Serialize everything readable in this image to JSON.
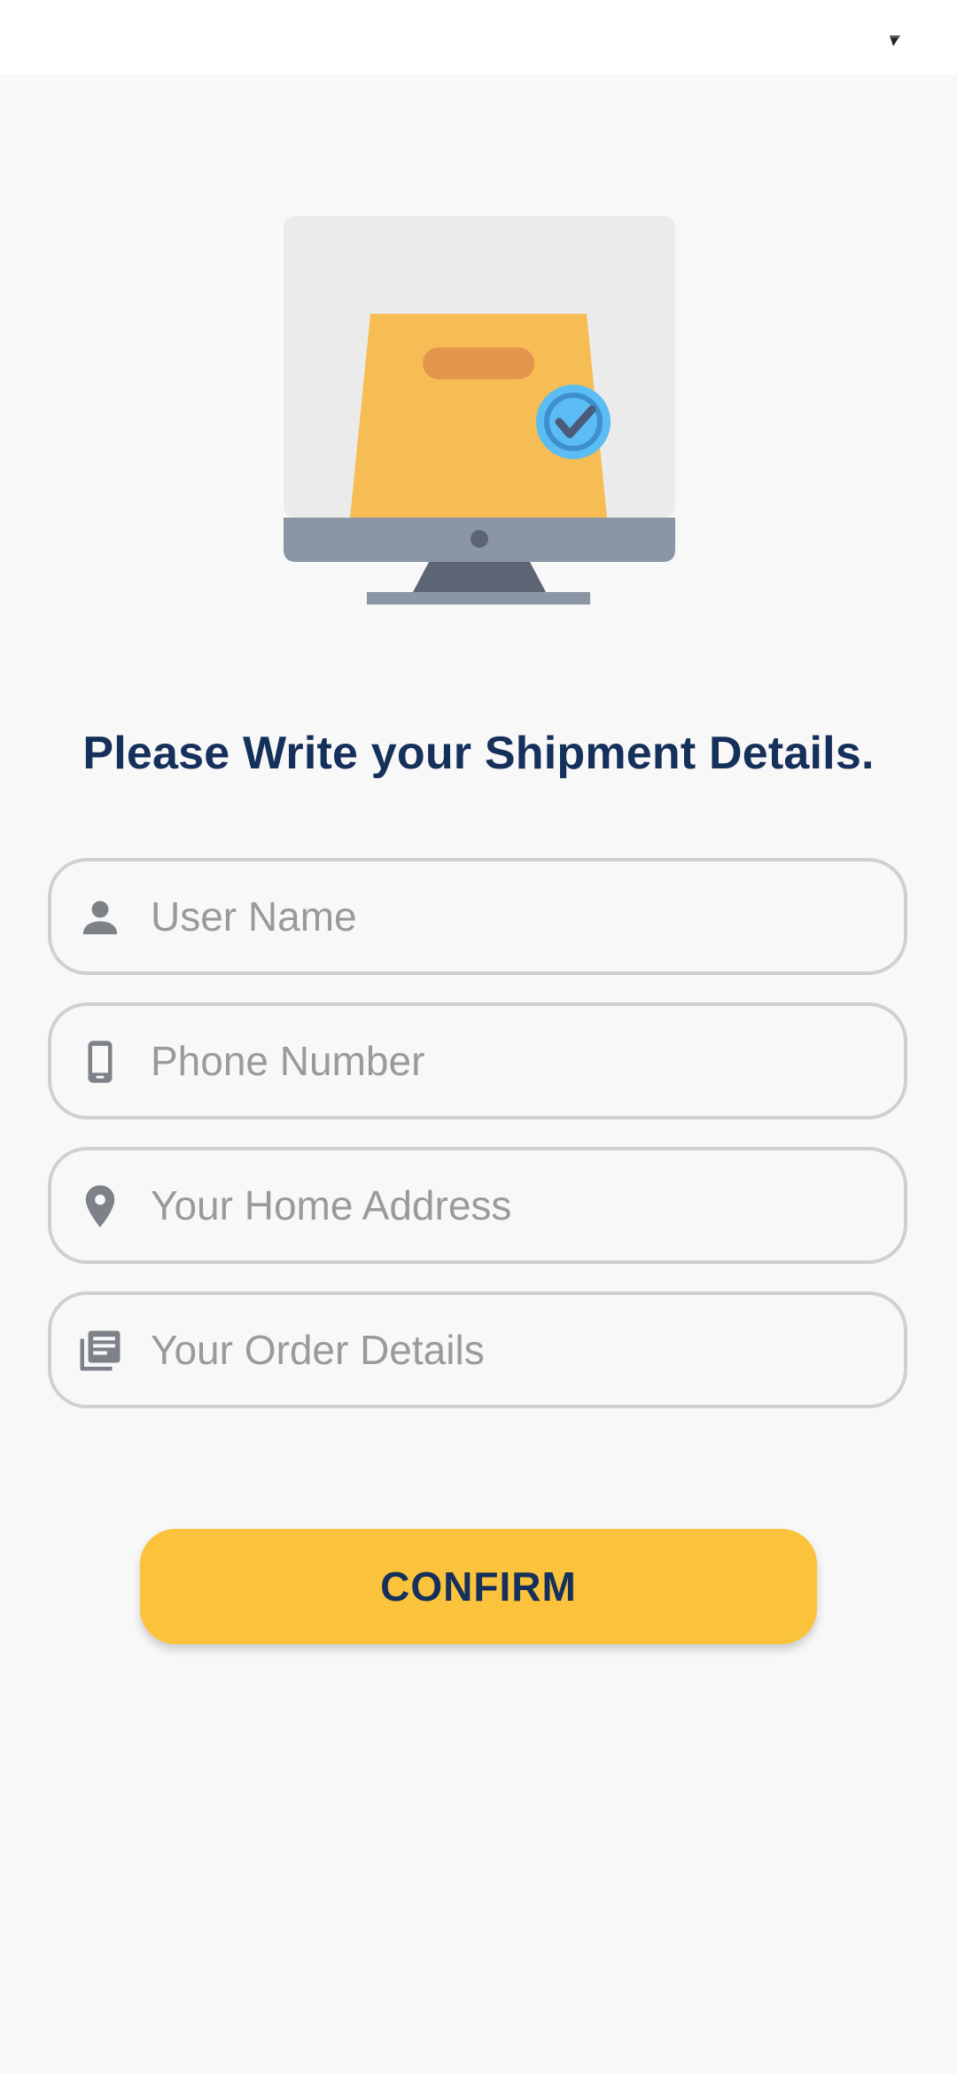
{
  "status_bar": {
    "icons": [
      "signal-icon"
    ]
  },
  "hero": {
    "icon": "monitor-shopping-bag-check-illustration",
    "colors": {
      "bag": "#f6bd54",
      "screen": "#ebebeb",
      "bezel": "#8a96a3",
      "check": "#5bbdf3"
    }
  },
  "form": {
    "title": "Please Write your Shipment Details.",
    "fields": [
      {
        "icon": "person-icon",
        "placeholder": "User Name",
        "value": ""
      },
      {
        "icon": "phone-icon",
        "placeholder": "Phone Number",
        "value": ""
      },
      {
        "icon": "location-pin-icon",
        "placeholder": "Your Home Address",
        "value": ""
      },
      {
        "icon": "order-details-icon",
        "placeholder": "Your Order Details",
        "value": ""
      }
    ],
    "confirm_label": "CONFIRM"
  },
  "colors": {
    "background": "#f8f8f8",
    "title_text": "#15305a",
    "field_border": "#d0d0d0",
    "placeholder": "#9a9a9a",
    "icon": "#7d8288",
    "button": "#fbc23b"
  }
}
